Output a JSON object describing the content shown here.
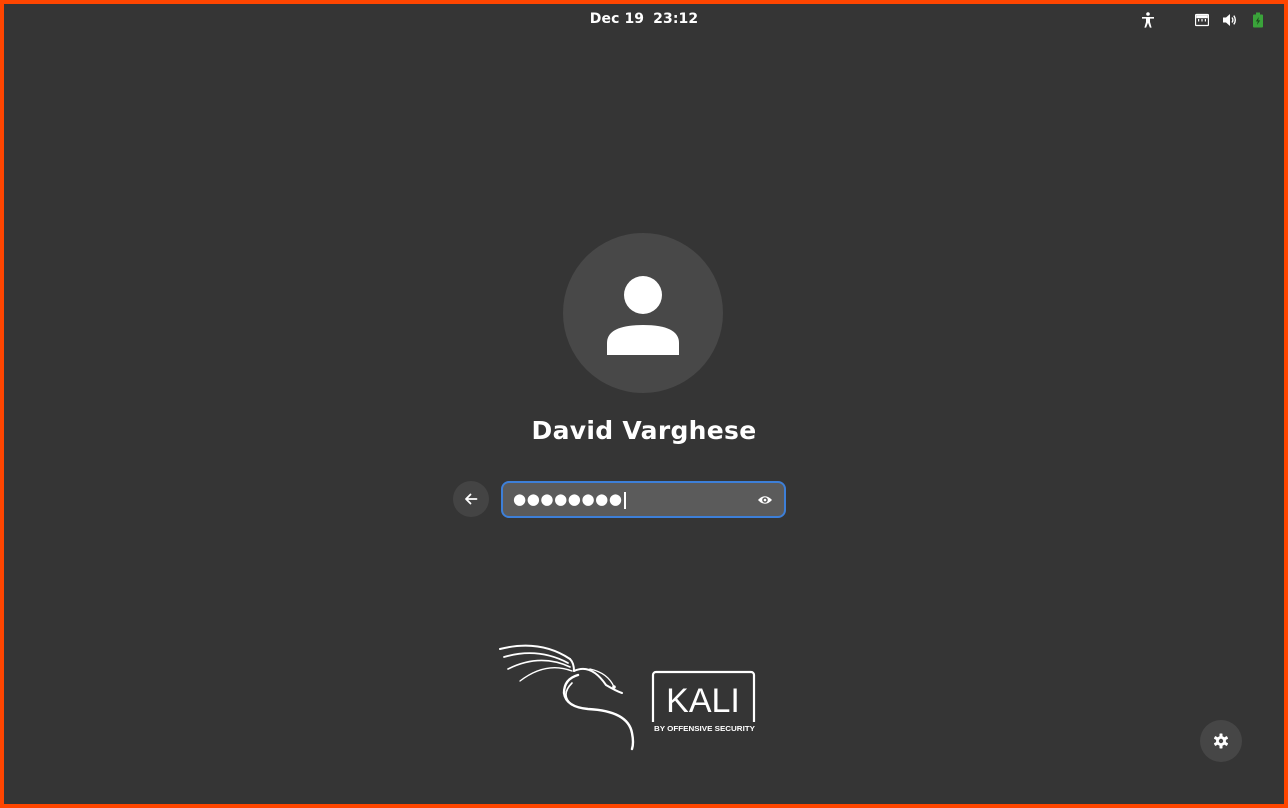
{
  "topbar": {
    "date": "Dec 19",
    "time": "23:12",
    "icons": [
      "accessibility-icon",
      "network-wired-icon",
      "volume-icon",
      "battery-icon"
    ]
  },
  "login": {
    "user_name": "David Varghese",
    "password_masked": "●●●●●●●●",
    "password_state": "focused"
  },
  "branding": {
    "logo_text": "KALI",
    "logo_tagline": "BY OFFENSIVE SECURITY"
  },
  "colors": {
    "background": "#353535",
    "accent": "#3d7fd8",
    "frame": "#ff4500",
    "battery": "#3aa33a"
  }
}
